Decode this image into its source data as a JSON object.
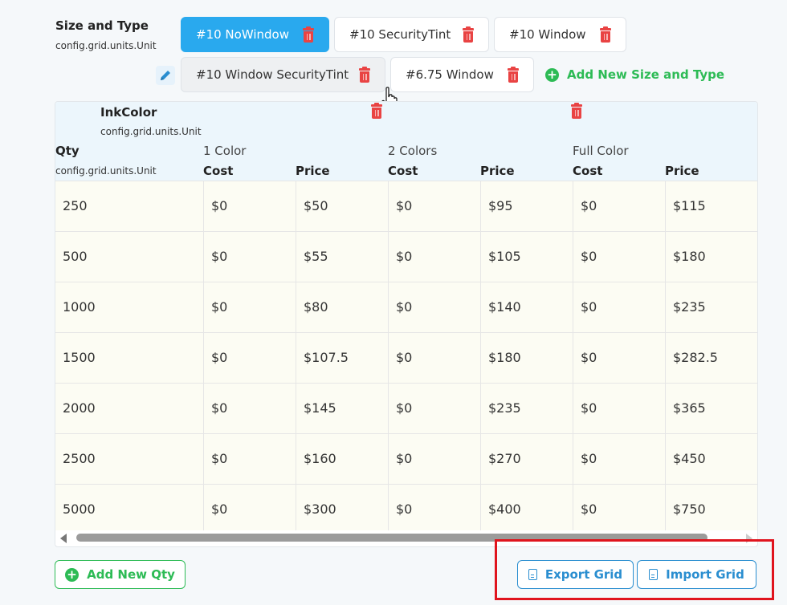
{
  "header": {
    "title": "Size and Type",
    "subtitle": "config.grid.units.Unit"
  },
  "size_types": [
    {
      "label": "#10 NoWindow",
      "state": "active"
    },
    {
      "label": "#10 SecurityTint",
      "state": "normal"
    },
    {
      "label": "#10 Window",
      "state": "normal"
    },
    {
      "label": "#10 Window SecurityTint",
      "state": "hover"
    },
    {
      "label": "#6.75 Window",
      "state": "normal"
    }
  ],
  "add_size_type_label": "Add New Size and Type",
  "grid": {
    "ink_title": "InkColor",
    "ink_subtitle": "config.grid.units.Unit",
    "qty_label": "Qty",
    "qty_subtitle": "config.grid.units.Unit",
    "groups": [
      "1 Color",
      "2 Colors",
      "Full Color"
    ],
    "sub_columns": [
      "Cost",
      "Price",
      "Cost",
      "Price",
      "Cost",
      "Price"
    ],
    "rows": [
      [
        "250",
        "$0",
        "$50",
        "$0",
        "$95",
        "$0",
        "$115"
      ],
      [
        "500",
        "$0",
        "$55",
        "$0",
        "$105",
        "$0",
        "$180"
      ],
      [
        "1000",
        "$0",
        "$80",
        "$0",
        "$140",
        "$0",
        "$235"
      ],
      [
        "1500",
        "$0",
        "$107.5",
        "$0",
        "$180",
        "$0",
        "$282.5"
      ],
      [
        "2000",
        "$0",
        "$145",
        "$0",
        "$235",
        "$0",
        "$365"
      ],
      [
        "2500",
        "$0",
        "$160",
        "$0",
        "$270",
        "$0",
        "$450"
      ],
      [
        "5000",
        "$0",
        "$300",
        "$0",
        "$400",
        "$0",
        "$750"
      ]
    ]
  },
  "buttons": {
    "add_qty": "Add New Qty",
    "export": "Export Grid",
    "import": "Import Grid"
  },
  "colors": {
    "accent": "#29a9ee",
    "danger": "#e94343",
    "success": "#2dbb55",
    "link_blue": "#2a8ed0",
    "highlight": "#e0141e"
  },
  "icons": [
    "trash-icon",
    "pencil-icon",
    "plus-circle-icon",
    "document-icon",
    "cursor-hand-icon"
  ]
}
